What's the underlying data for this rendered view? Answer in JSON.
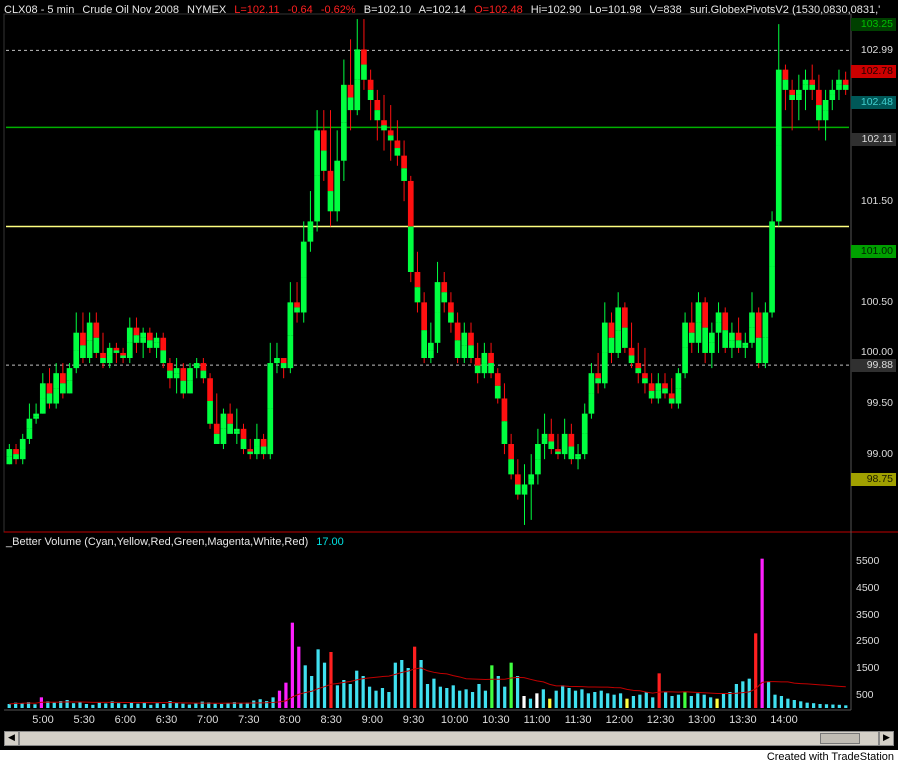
{
  "header": {
    "symbol": "CLX08 - 5 min",
    "description": "Crude Oil Nov 2008",
    "exchange": "NYMEX",
    "last": "L=102.11",
    "net_change": "-0.64",
    "pct_change": "-0.62%",
    "bid": "B=102.10",
    "ask": "A=102.14",
    "open": "O=102.48",
    "high": "Hi=102.90",
    "low": "Lo=101.98",
    "volume": "V=838",
    "study": "suri.GlobexPivotsV2 (1530,0830,0831,'"
  },
  "indicator": {
    "name": "_Better Volume (Cyan,Yellow,Red,Green,Magenta,White,Red)",
    "value": "17.00"
  },
  "price_axis_labels": [
    {
      "text": "103.25",
      "bg": "#004000",
      "fg": "#00c000",
      "value": 103.25
    },
    {
      "text": "102.99",
      "bg": "#000000",
      "fg": "#dddddd",
      "value": 102.99
    },
    {
      "text": "102.78",
      "bg": "#ff2020",
      "fg": "#ff2020",
      "value": 102.78
    },
    {
      "text": "102.48",
      "bg": "#006060",
      "fg": "#00c0c0",
      "value": 102.48
    },
    {
      "text": "102.11",
      "bg": "#303030",
      "fg": "#dddddd",
      "value": 102.11
    },
    {
      "text": "101.50",
      "bg": "#000000",
      "fg": "#dddddd",
      "value": 101.5
    },
    {
      "text": "101.00",
      "bg": "#00a000",
      "fg": "#001000",
      "value": 101.0
    },
    {
      "text": "100.50",
      "bg": "#000000",
      "fg": "#dddddd",
      "value": 100.5
    },
    {
      "text": "100.00",
      "bg": "#000000",
      "fg": "#dddddd",
      "value": 100.0
    },
    {
      "text": "99.88",
      "bg": "#303030",
      "fg": "#dddddd",
      "value": 99.88
    },
    {
      "text": "99.50",
      "bg": "#000000",
      "fg": "#dddddd",
      "value": 99.5
    },
    {
      "text": "99.00",
      "bg": "#000000",
      "fg": "#dddddd",
      "value": 99.0
    },
    {
      "text": "98.75",
      "bg": "#a0a000",
      "fg": "#202000",
      "value": 98.75
    }
  ],
  "volume_axis_labels": [
    "5500",
    "4500",
    "3500",
    "2500",
    "1500",
    "500"
  ],
  "time_labels": [
    "5:00",
    "5:30",
    "6:00",
    "6:30",
    "7:00",
    "7:30",
    "8:00",
    "8:30",
    "9:00",
    "9:30",
    "10:00",
    "10:30",
    "11:00",
    "11:30",
    "12:00",
    "12:30",
    "13:00",
    "13:30",
    "14:00"
  ],
  "footer": {
    "credit": "Created with TradeStation"
  },
  "colors": {
    "background": "#000000",
    "bull": "#00ff40",
    "bear": "#ff1010",
    "pivot_green": "#00b000",
    "pivot_yellow": "#ffff80",
    "dotted_line": "#c0c0c0",
    "vol_cyan": "#40e0f0",
    "vol_magenta": "#ff20ff",
    "vol_red": "#ff2020",
    "vol_green": "#40ff40",
    "vol_yellow": "#ffff40",
    "vol_white": "#ffffff"
  },
  "chart_data": {
    "type": "candlestick",
    "title": "CLX08 - 5 min",
    "y_range": [
      98.25,
      103.35
    ],
    "reference_lines": [
      {
        "value": 102.99,
        "style": "dotted"
      },
      {
        "value": 102.23,
        "style": "solid",
        "color": "green"
      },
      {
        "value": 101.25,
        "style": "solid",
        "color": "yellow"
      },
      {
        "value": 99.88,
        "style": "dotted"
      }
    ],
    "candles_ohlc": [
      [
        98.9,
        99.1,
        98.9,
        99.05
      ],
      [
        99.05,
        99.1,
        98.9,
        98.95
      ],
      [
        98.95,
        99.2,
        98.9,
        99.15
      ],
      [
        99.15,
        99.5,
        99.1,
        99.35
      ],
      [
        99.35,
        99.5,
        99.3,
        99.4
      ],
      [
        99.4,
        99.8,
        99.4,
        99.7
      ],
      [
        99.7,
        99.85,
        99.45,
        99.5
      ],
      [
        99.5,
        99.9,
        99.45,
        99.8
      ],
      [
        99.8,
        99.9,
        99.55,
        99.6
      ],
      [
        99.6,
        99.9,
        99.6,
        99.85
      ],
      [
        99.85,
        100.4,
        99.8,
        100.2
      ],
      [
        100.2,
        100.4,
        99.9,
        99.95
      ],
      [
        99.95,
        100.4,
        99.9,
        100.3
      ],
      [
        100.3,
        100.4,
        99.95,
        100.0
      ],
      [
        100.0,
        100.2,
        99.85,
        99.9
      ],
      [
        99.9,
        100.1,
        99.85,
        100.05
      ],
      [
        100.05,
        100.1,
        99.9,
        100.0
      ],
      [
        100.0,
        100.05,
        99.9,
        99.95
      ],
      [
        99.95,
        100.35,
        99.9,
        100.25
      ],
      [
        100.25,
        100.35,
        100.0,
        100.1
      ],
      [
        100.1,
        100.25,
        99.95,
        100.2
      ],
      [
        100.2,
        100.25,
        100.0,
        100.05
      ],
      [
        100.05,
        100.2,
        99.95,
        100.15
      ],
      [
        100.15,
        100.2,
        99.85,
        99.9
      ],
      [
        99.9,
        99.95,
        99.65,
        99.75
      ],
      [
        99.75,
        99.95,
        99.6,
        99.85
      ],
      [
        99.85,
        99.9,
        99.55,
        99.6
      ],
      [
        99.6,
        99.9,
        99.6,
        99.85
      ],
      [
        99.85,
        99.95,
        99.75,
        99.9
      ],
      [
        99.9,
        99.95,
        99.7,
        99.75
      ],
      [
        99.75,
        99.8,
        99.25,
        99.3
      ],
      [
        99.3,
        99.6,
        99.1,
        99.1
      ],
      [
        99.1,
        99.45,
        99.05,
        99.4
      ],
      [
        99.4,
        99.5,
        99.2,
        99.2
      ],
      [
        99.2,
        99.45,
        99.1,
        99.25
      ],
      [
        99.25,
        99.3,
        99.0,
        99.05
      ],
      [
        99.05,
        99.15,
        98.95,
        99.0
      ],
      [
        99.0,
        99.3,
        98.95,
        99.15
      ],
      [
        99.15,
        99.2,
        98.95,
        99.0
      ],
      [
        99.0,
        100.1,
        98.95,
        99.9
      ],
      [
        99.9,
        100.1,
        99.8,
        99.95
      ],
      [
        99.95,
        99.95,
        99.75,
        99.85
      ],
      [
        99.85,
        100.7,
        99.8,
        100.5
      ],
      [
        100.5,
        100.7,
        100.3,
        100.4
      ],
      [
        100.4,
        101.3,
        100.3,
        101.1
      ],
      [
        101.1,
        101.6,
        101.0,
        101.3
      ],
      [
        101.3,
        102.4,
        101.2,
        102.2
      ],
      [
        102.2,
        102.4,
        101.7,
        101.8
      ],
      [
        101.8,
        102.4,
        101.25,
        101.4
      ],
      [
        101.4,
        102.2,
        101.3,
        101.9
      ],
      [
        101.9,
        102.9,
        101.7,
        102.65
      ],
      [
        102.65,
        103.1,
        102.2,
        102.4
      ],
      [
        102.4,
        103.3,
        102.35,
        103.0
      ],
      [
        103.0,
        103.3,
        102.6,
        102.7
      ],
      [
        102.7,
        102.8,
        102.3,
        102.5
      ],
      [
        102.5,
        102.6,
        102.1,
        102.3
      ],
      [
        102.3,
        102.55,
        102.0,
        102.2
      ],
      [
        102.2,
        102.45,
        101.9,
        102.1
      ],
      [
        102.1,
        102.3,
        101.85,
        101.95
      ],
      [
        101.95,
        102.1,
        101.5,
        101.7
      ],
      [
        101.7,
        101.75,
        100.7,
        100.8
      ],
      [
        100.8,
        101.0,
        100.4,
        100.5
      ],
      [
        100.5,
        100.6,
        99.9,
        99.95
      ],
      [
        99.95,
        100.3,
        99.9,
        100.1
      ],
      [
        100.1,
        100.9,
        100.0,
        100.7
      ],
      [
        100.7,
        100.8,
        100.4,
        100.5
      ],
      [
        100.5,
        100.6,
        100.2,
        100.3
      ],
      [
        100.3,
        100.4,
        99.9,
        99.95
      ],
      [
        99.95,
        100.3,
        99.9,
        100.2
      ],
      [
        100.2,
        100.3,
        99.9,
        99.95
      ],
      [
        99.95,
        100.1,
        99.7,
        99.8
      ],
      [
        99.8,
        100.1,
        99.75,
        100.0
      ],
      [
        100.0,
        100.1,
        99.75,
        99.8
      ],
      [
        99.8,
        99.85,
        99.5,
        99.55
      ],
      [
        99.55,
        99.7,
        99.0,
        99.1
      ],
      [
        99.1,
        99.2,
        98.75,
        98.8
      ],
      [
        98.8,
        98.95,
        98.55,
        98.6
      ],
      [
        98.6,
        98.9,
        98.3,
        98.7
      ],
      [
        98.7,
        99.0,
        98.35,
        98.8
      ],
      [
        98.8,
        99.25,
        98.7,
        99.1
      ],
      [
        99.1,
        99.4,
        98.95,
        99.2
      ],
      [
        99.2,
        99.35,
        99.0,
        99.05
      ],
      [
        99.05,
        99.2,
        98.95,
        99.0
      ],
      [
        99.0,
        99.35,
        98.95,
        99.2
      ],
      [
        99.2,
        99.3,
        98.9,
        98.95
      ],
      [
        98.95,
        99.1,
        98.85,
        99.0
      ],
      [
        99.0,
        99.5,
        98.95,
        99.4
      ],
      [
        99.4,
        99.9,
        99.35,
        99.8
      ],
      [
        99.8,
        100.0,
        99.6,
        99.7
      ],
      [
        99.7,
        100.5,
        99.65,
        100.3
      ],
      [
        100.3,
        100.4,
        99.9,
        100.0
      ],
      [
        100.0,
        100.6,
        99.95,
        100.45
      ],
      [
        100.45,
        100.5,
        100.0,
        100.05
      ],
      [
        100.05,
        100.3,
        99.85,
        99.9
      ],
      [
        99.9,
        100.1,
        99.7,
        99.8
      ],
      [
        99.8,
        100.05,
        99.6,
        99.7
      ],
      [
        99.7,
        99.8,
        99.5,
        99.55
      ],
      [
        99.55,
        99.8,
        99.5,
        99.7
      ],
      [
        99.7,
        99.8,
        99.55,
        99.6
      ],
      [
        99.6,
        99.75,
        99.45,
        99.5
      ],
      [
        99.5,
        99.85,
        99.45,
        99.8
      ],
      [
        99.8,
        100.4,
        99.75,
        100.3
      ],
      [
        100.3,
        100.5,
        100.0,
        100.1
      ],
      [
        100.1,
        100.6,
        100.0,
        100.5
      ],
      [
        100.5,
        100.55,
        99.9,
        100.0
      ],
      [
        100.0,
        100.3,
        99.85,
        100.2
      ],
      [
        100.2,
        100.5,
        100.0,
        100.4
      ],
      [
        100.4,
        100.45,
        100.0,
        100.05
      ],
      [
        100.05,
        100.3,
        99.95,
        100.2
      ],
      [
        100.2,
        100.35,
        100.0,
        100.05
      ],
      [
        100.05,
        100.2,
        99.95,
        100.1
      ],
      [
        100.1,
        100.6,
        100.05,
        100.4
      ],
      [
        100.4,
        100.45,
        99.85,
        99.9
      ],
      [
        99.9,
        100.5,
        99.85,
        100.4
      ],
      [
        100.4,
        101.4,
        100.35,
        101.3
      ],
      [
        101.3,
        103.25,
        101.25,
        102.8
      ],
      [
        102.8,
        102.85,
        102.4,
        102.6
      ],
      [
        102.6,
        102.7,
        102.2,
        102.5
      ],
      [
        102.5,
        102.75,
        102.3,
        102.6
      ],
      [
        102.6,
        102.8,
        102.4,
        102.7
      ],
      [
        102.7,
        102.85,
        102.5,
        102.6
      ],
      [
        102.6,
        102.75,
        102.2,
        102.3
      ],
      [
        102.3,
        102.6,
        102.1,
        102.5
      ],
      [
        102.5,
        102.7,
        102.4,
        102.6
      ],
      [
        102.6,
        102.8,
        102.5,
        102.7
      ],
      [
        102.7,
        102.78,
        102.55,
        102.6
      ]
    ],
    "volume": [
      {
        "v": 150,
        "c": "cyan"
      },
      {
        "v": 200,
        "c": "cyan"
      },
      {
        "v": 180,
        "c": "cyan"
      },
      {
        "v": 220,
        "c": "cyan"
      },
      {
        "v": 140,
        "c": "cyan"
      },
      {
        "v": 400,
        "c": "magenta"
      },
      {
        "v": 250,
        "c": "cyan"
      },
      {
        "v": 200,
        "c": "cyan"
      },
      {
        "v": 260,
        "c": "cyan"
      },
      {
        "v": 300,
        "c": "cyan"
      },
      {
        "v": 180,
        "c": "cyan"
      },
      {
        "v": 220,
        "c": "cyan"
      },
      {
        "v": 150,
        "c": "cyan"
      },
      {
        "v": 120,
        "c": "cyan"
      },
      {
        "v": 200,
        "c": "cyan"
      },
      {
        "v": 170,
        "c": "cyan"
      },
      {
        "v": 250,
        "c": "cyan"
      },
      {
        "v": 180,
        "c": "cyan"
      },
      {
        "v": 140,
        "c": "cyan"
      },
      {
        "v": 200,
        "c": "cyan"
      },
      {
        "v": 160,
        "c": "cyan"
      },
      {
        "v": 220,
        "c": "cyan"
      },
      {
        "v": 120,
        "c": "cyan"
      },
      {
        "v": 180,
        "c": "cyan"
      },
      {
        "v": 150,
        "c": "cyan"
      },
      {
        "v": 260,
        "c": "cyan"
      },
      {
        "v": 190,
        "c": "cyan"
      },
      {
        "v": 160,
        "c": "cyan"
      },
      {
        "v": 130,
        "c": "cyan"
      },
      {
        "v": 170,
        "c": "cyan"
      },
      {
        "v": 240,
        "c": "cyan"
      },
      {
        "v": 210,
        "c": "cyan"
      },
      {
        "v": 160,
        "c": "cyan"
      },
      {
        "v": 150,
        "c": "cyan"
      },
      {
        "v": 180,
        "c": "cyan"
      },
      {
        "v": 220,
        "c": "cyan"
      },
      {
        "v": 170,
        "c": "cyan"
      },
      {
        "v": 200,
        "c": "cyan"
      },
      {
        "v": 280,
        "c": "cyan"
      },
      {
        "v": 330,
        "c": "cyan"
      },
      {
        "v": 260,
        "c": "cyan"
      },
      {
        "v": 400,
        "c": "cyan"
      },
      {
        "v": 650,
        "c": "magenta"
      },
      {
        "v": 950,
        "c": "magenta"
      },
      {
        "v": 3200,
        "c": "magenta"
      },
      {
        "v": 2300,
        "c": "magenta"
      },
      {
        "v": 1600,
        "c": "cyan"
      },
      {
        "v": 1200,
        "c": "cyan"
      },
      {
        "v": 2200,
        "c": "cyan"
      },
      {
        "v": 1700,
        "c": "cyan"
      },
      {
        "v": 2100,
        "c": "red"
      },
      {
        "v": 850,
        "c": "cyan"
      },
      {
        "v": 1050,
        "c": "cyan"
      },
      {
        "v": 900,
        "c": "cyan"
      },
      {
        "v": 1400,
        "c": "cyan"
      },
      {
        "v": 1200,
        "c": "cyan"
      },
      {
        "v": 800,
        "c": "cyan"
      },
      {
        "v": 650,
        "c": "cyan"
      },
      {
        "v": 750,
        "c": "cyan"
      },
      {
        "v": 600,
        "c": "cyan"
      },
      {
        "v": 1700,
        "c": "cyan"
      },
      {
        "v": 1800,
        "c": "cyan"
      },
      {
        "v": 1500,
        "c": "cyan"
      },
      {
        "v": 2300,
        "c": "red"
      },
      {
        "v": 1800,
        "c": "cyan"
      },
      {
        "v": 900,
        "c": "cyan"
      },
      {
        "v": 1100,
        "c": "cyan"
      },
      {
        "v": 800,
        "c": "cyan"
      },
      {
        "v": 750,
        "c": "cyan"
      },
      {
        "v": 850,
        "c": "cyan"
      },
      {
        "v": 650,
        "c": "cyan"
      },
      {
        "v": 700,
        "c": "cyan"
      },
      {
        "v": 600,
        "c": "cyan"
      },
      {
        "v": 900,
        "c": "cyan"
      },
      {
        "v": 650,
        "c": "cyan"
      },
      {
        "v": 1600,
        "c": "green"
      },
      {
        "v": 1200,
        "c": "cyan"
      },
      {
        "v": 800,
        "c": "cyan"
      },
      {
        "v": 1700,
        "c": "green"
      },
      {
        "v": 1200,
        "c": "cyan"
      },
      {
        "v": 450,
        "c": "white"
      },
      {
        "v": 350,
        "c": "cyan"
      },
      {
        "v": 550,
        "c": "white"
      },
      {
        "v": 700,
        "c": "cyan"
      },
      {
        "v": 350,
        "c": "yellow"
      },
      {
        "v": 650,
        "c": "cyan"
      },
      {
        "v": 850,
        "c": "cyan"
      },
      {
        "v": 750,
        "c": "cyan"
      },
      {
        "v": 650,
        "c": "cyan"
      },
      {
        "v": 700,
        "c": "cyan"
      },
      {
        "v": 550,
        "c": "cyan"
      },
      {
        "v": 600,
        "c": "cyan"
      },
      {
        "v": 650,
        "c": "cyan"
      },
      {
        "v": 550,
        "c": "cyan"
      },
      {
        "v": 500,
        "c": "cyan"
      },
      {
        "v": 550,
        "c": "cyan"
      },
      {
        "v": 350,
        "c": "yellow"
      },
      {
        "v": 450,
        "c": "cyan"
      },
      {
        "v": 500,
        "c": "cyan"
      },
      {
        "v": 600,
        "c": "cyan"
      },
      {
        "v": 400,
        "c": "cyan"
      },
      {
        "v": 1300,
        "c": "red"
      },
      {
        "v": 600,
        "c": "cyan"
      },
      {
        "v": 450,
        "c": "cyan"
      },
      {
        "v": 500,
        "c": "cyan"
      },
      {
        "v": 600,
        "c": "green"
      },
      {
        "v": 450,
        "c": "cyan"
      },
      {
        "v": 550,
        "c": "cyan"
      },
      {
        "v": 500,
        "c": "cyan"
      },
      {
        "v": 400,
        "c": "cyan"
      },
      {
        "v": 350,
        "c": "yellow"
      },
      {
        "v": 550,
        "c": "cyan"
      },
      {
        "v": 600,
        "c": "cyan"
      },
      {
        "v": 900,
        "c": "cyan"
      },
      {
        "v": 1000,
        "c": "cyan"
      },
      {
        "v": 1100,
        "c": "cyan"
      },
      {
        "v": 2800,
        "c": "red"
      },
      {
        "v": 5600,
        "c": "magenta"
      },
      {
        "v": 1000,
        "c": "cyan"
      },
      {
        "v": 500,
        "c": "cyan"
      },
      {
        "v": 450,
        "c": "cyan"
      },
      {
        "v": 350,
        "c": "cyan"
      },
      {
        "v": 300,
        "c": "cyan"
      },
      {
        "v": 250,
        "c": "cyan"
      },
      {
        "v": 200,
        "c": "cyan"
      },
      {
        "v": 180,
        "c": "cyan"
      },
      {
        "v": 150,
        "c": "cyan"
      },
      {
        "v": 140,
        "c": "cyan"
      },
      {
        "v": 130,
        "c": "cyan"
      },
      {
        "v": 120,
        "c": "cyan"
      },
      {
        "v": 100,
        "c": "cyan"
      }
    ],
    "volume_y_range": [
      0,
      6000
    ]
  }
}
